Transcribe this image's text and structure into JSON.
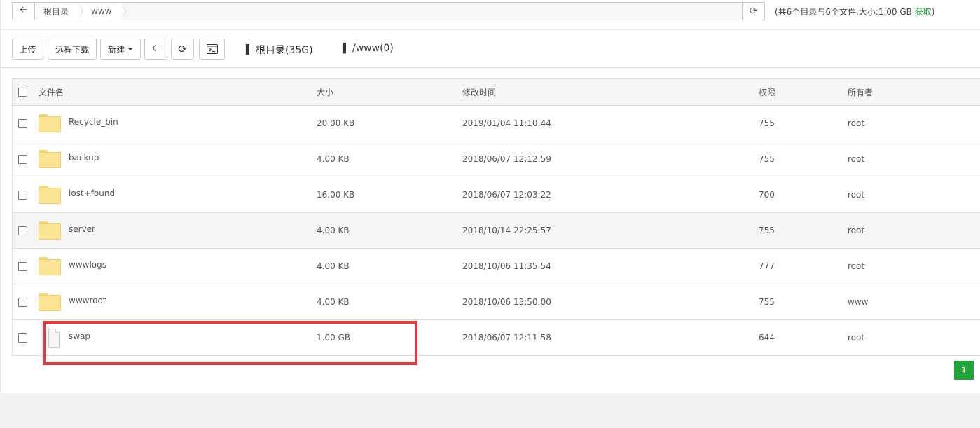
{
  "pathbar": {
    "back_icon": "arrow-left",
    "crumbs": [
      "根目录",
      "www"
    ],
    "refresh_icon": "refresh"
  },
  "summary": {
    "text": "(共6个目录与6个文件,大小:1.00 GB ",
    "link": "获取",
    "close": ")"
  },
  "toolbar": {
    "upload": "上传",
    "remote_download": "远程下载",
    "new": "新建",
    "back_icon": "arrow-left",
    "refresh_icon": "refresh",
    "terminal_icon": "terminal",
    "disks": [
      {
        "label": "根目录(35G)",
        "icon": "hdd"
      },
      {
        "label": "/www(0)",
        "icon": "hdd"
      }
    ]
  },
  "table": {
    "headers": {
      "name": "文件名",
      "size": "大小",
      "time": "修改时间",
      "perm": "权限",
      "owner": "所有者"
    },
    "rows": [
      {
        "type": "folder",
        "name": "Recycle_bin",
        "size": "20.00 KB",
        "time": "2019/01/04 11:10:44",
        "perm": "755",
        "owner": "root"
      },
      {
        "type": "folder",
        "name": "backup",
        "size": "4.00 KB",
        "time": "2018/06/07 12:12:59",
        "perm": "755",
        "owner": "root"
      },
      {
        "type": "folder",
        "name": "lost+found",
        "size": "16.00 KB",
        "time": "2018/06/07 12:03:22",
        "perm": "700",
        "owner": "root"
      },
      {
        "type": "folder",
        "name": "server",
        "size": "4.00 KB",
        "time": "2018/10/14 22:25:57",
        "perm": "755",
        "owner": "root"
      },
      {
        "type": "folder",
        "name": "wwwlogs",
        "size": "4.00 KB",
        "time": "2018/10/06 11:35:54",
        "perm": "777",
        "owner": "root"
      },
      {
        "type": "folder",
        "name": "wwwroot",
        "size": "4.00 KB",
        "time": "2018/10/06 13:50:00",
        "perm": "755",
        "owner": "www"
      },
      {
        "type": "file",
        "name": "swap",
        "size": "1.00 GB",
        "time": "2018/06/07 12:11:58",
        "perm": "644",
        "owner": "root"
      }
    ]
  },
  "pager": {
    "current": "1"
  },
  "colors": {
    "accent": "#20a53a",
    "highlight": "#e8393f",
    "folder": "#fbe394"
  }
}
